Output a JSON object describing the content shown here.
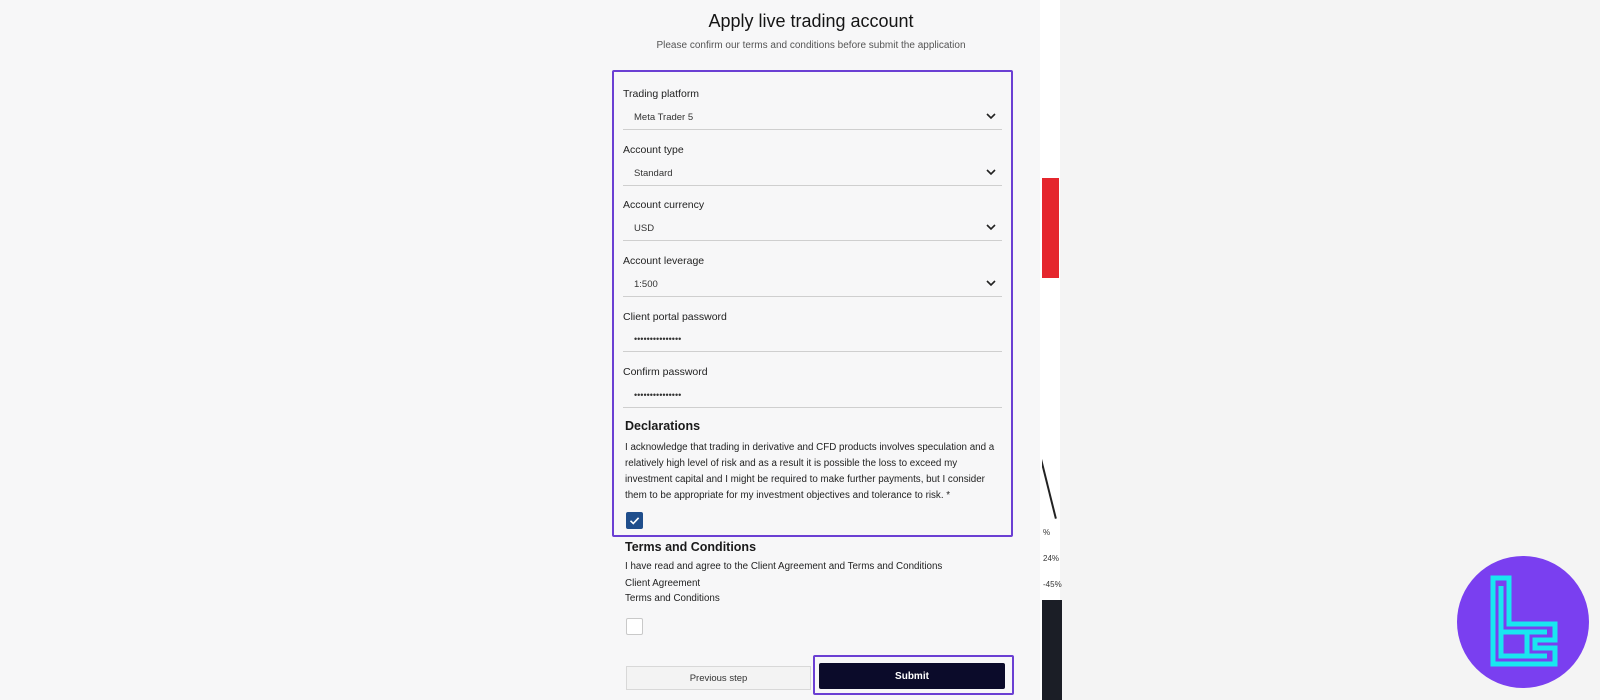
{
  "form": {
    "title": "Apply live trading account",
    "subtitle": "Please confirm our terms and conditions before submit the application",
    "fields": [
      {
        "label": "Trading platform",
        "value": "Meta Trader 5",
        "type": "select"
      },
      {
        "label": "Account type",
        "value": "Standard",
        "type": "select"
      },
      {
        "label": "Account currency",
        "value": "USD",
        "type": "select"
      },
      {
        "label": "Account leverage",
        "value": "1:500",
        "type": "select"
      },
      {
        "label": "Client portal password",
        "value": "•••••••••••••••",
        "type": "password"
      },
      {
        "label": "Confirm password",
        "value": "•••••••••••••••",
        "type": "password"
      }
    ],
    "declarations": {
      "title": "Declarations",
      "text": "I acknowledge that trading in derivative and CFD products involves speculation and a relatively high level of risk and as a result it is possible the loss to exceed my investment capital and I might be required to make further payments, but I consider them to be appropriate for my investment objectives and tolerance to risk. *",
      "checked": true
    },
    "terms": {
      "title": "Terms and Conditions",
      "text": "I have read and agree to the Client Agreement and Terms and Conditions",
      "link1": "Client Agreement",
      "link2": "Terms and Conditions",
      "checked": false
    },
    "buttons": {
      "previous": "Previous step",
      "submit": "Submit"
    }
  },
  "background": {
    "pct1": "%",
    "pct2": "24%",
    "pct3": "-45%"
  },
  "colors": {
    "highlight": "#6b3fd3",
    "submit": "#0b0b2a",
    "checkbox": "#1f4e8c",
    "logo": "#7a3ff0",
    "logo_mark": "#19e6f0"
  }
}
